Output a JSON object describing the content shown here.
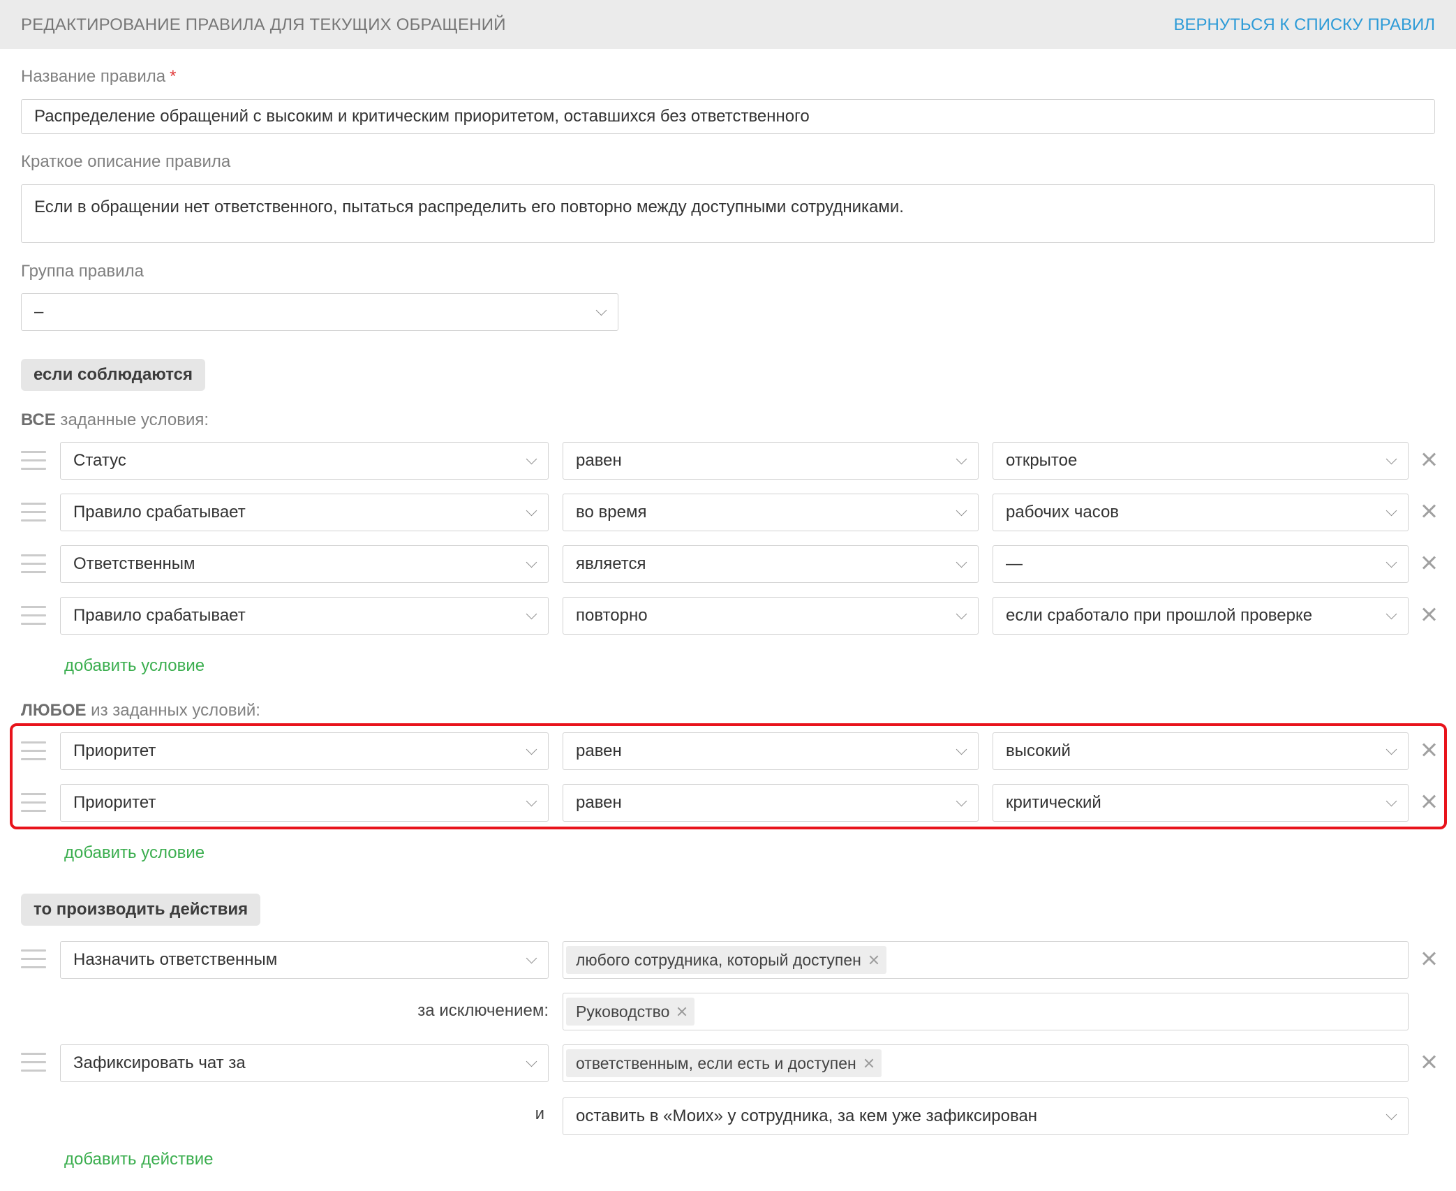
{
  "header": {
    "title": "РЕДАКТИРОВАНИЕ ПРАВИЛА ДЛЯ ТЕКУЩИХ ОБРАЩЕНИЙ",
    "back_link": "ВЕРНУТЬСЯ К СПИСКУ ПРАВИЛ"
  },
  "form": {
    "name_label": "Название правила",
    "required_mark": "*",
    "name_value": "Распределение обращений с высоким и критическим приоритетом, оставшихся без ответственного",
    "description_label": "Краткое описание правила",
    "description_value": "Если в обращении нет ответственного, пытаться распределить его повторно между доступными сотрудниками.",
    "group_label": "Группа правила",
    "group_value": "–"
  },
  "conditions": {
    "section_label": "если соблюдаются",
    "all_group": {
      "label_bold": "ВСЕ",
      "label_rest": " заданные условия:",
      "rows": [
        {
          "field": "Статус",
          "operator": "равен",
          "value": "открытое"
        },
        {
          "field": "Правило срабатывает",
          "operator": "во время",
          "value": "рабочих часов"
        },
        {
          "field": "Ответственным",
          "operator": "является",
          "value": "—"
        },
        {
          "field": "Правило срабатывает",
          "operator": "повторно",
          "value": "если сработало при прошлой проверке"
        }
      ],
      "add_label": "добавить условие"
    },
    "any_group": {
      "label_bold": "ЛЮБОЕ",
      "label_rest": " из заданных условий:",
      "rows": [
        {
          "field": "Приоритет",
          "operator": "равен",
          "value": "высокий"
        },
        {
          "field": "Приоритет",
          "operator": "равен",
          "value": "критический"
        }
      ],
      "add_label": "добавить условие"
    }
  },
  "actions": {
    "section_label": "то производить действия",
    "rows": [
      {
        "action": "Назначить ответственным",
        "tag": "любого сотрудника, который доступен",
        "except_label": "за исключением:",
        "except_tag": "Руководство"
      },
      {
        "action": "Зафиксировать чат за",
        "tag": "ответственным, если есть и доступен",
        "and_label": "и",
        "and_value": "оставить в «Моих» у сотрудника, за кем уже зафиксирован"
      }
    ],
    "add_label": "добавить действие"
  },
  "colors": {
    "link_blue": "#2d9bd7",
    "add_green": "#3bae4f",
    "highlight_red": "#e8131b",
    "required_red": "#e03a3a"
  }
}
